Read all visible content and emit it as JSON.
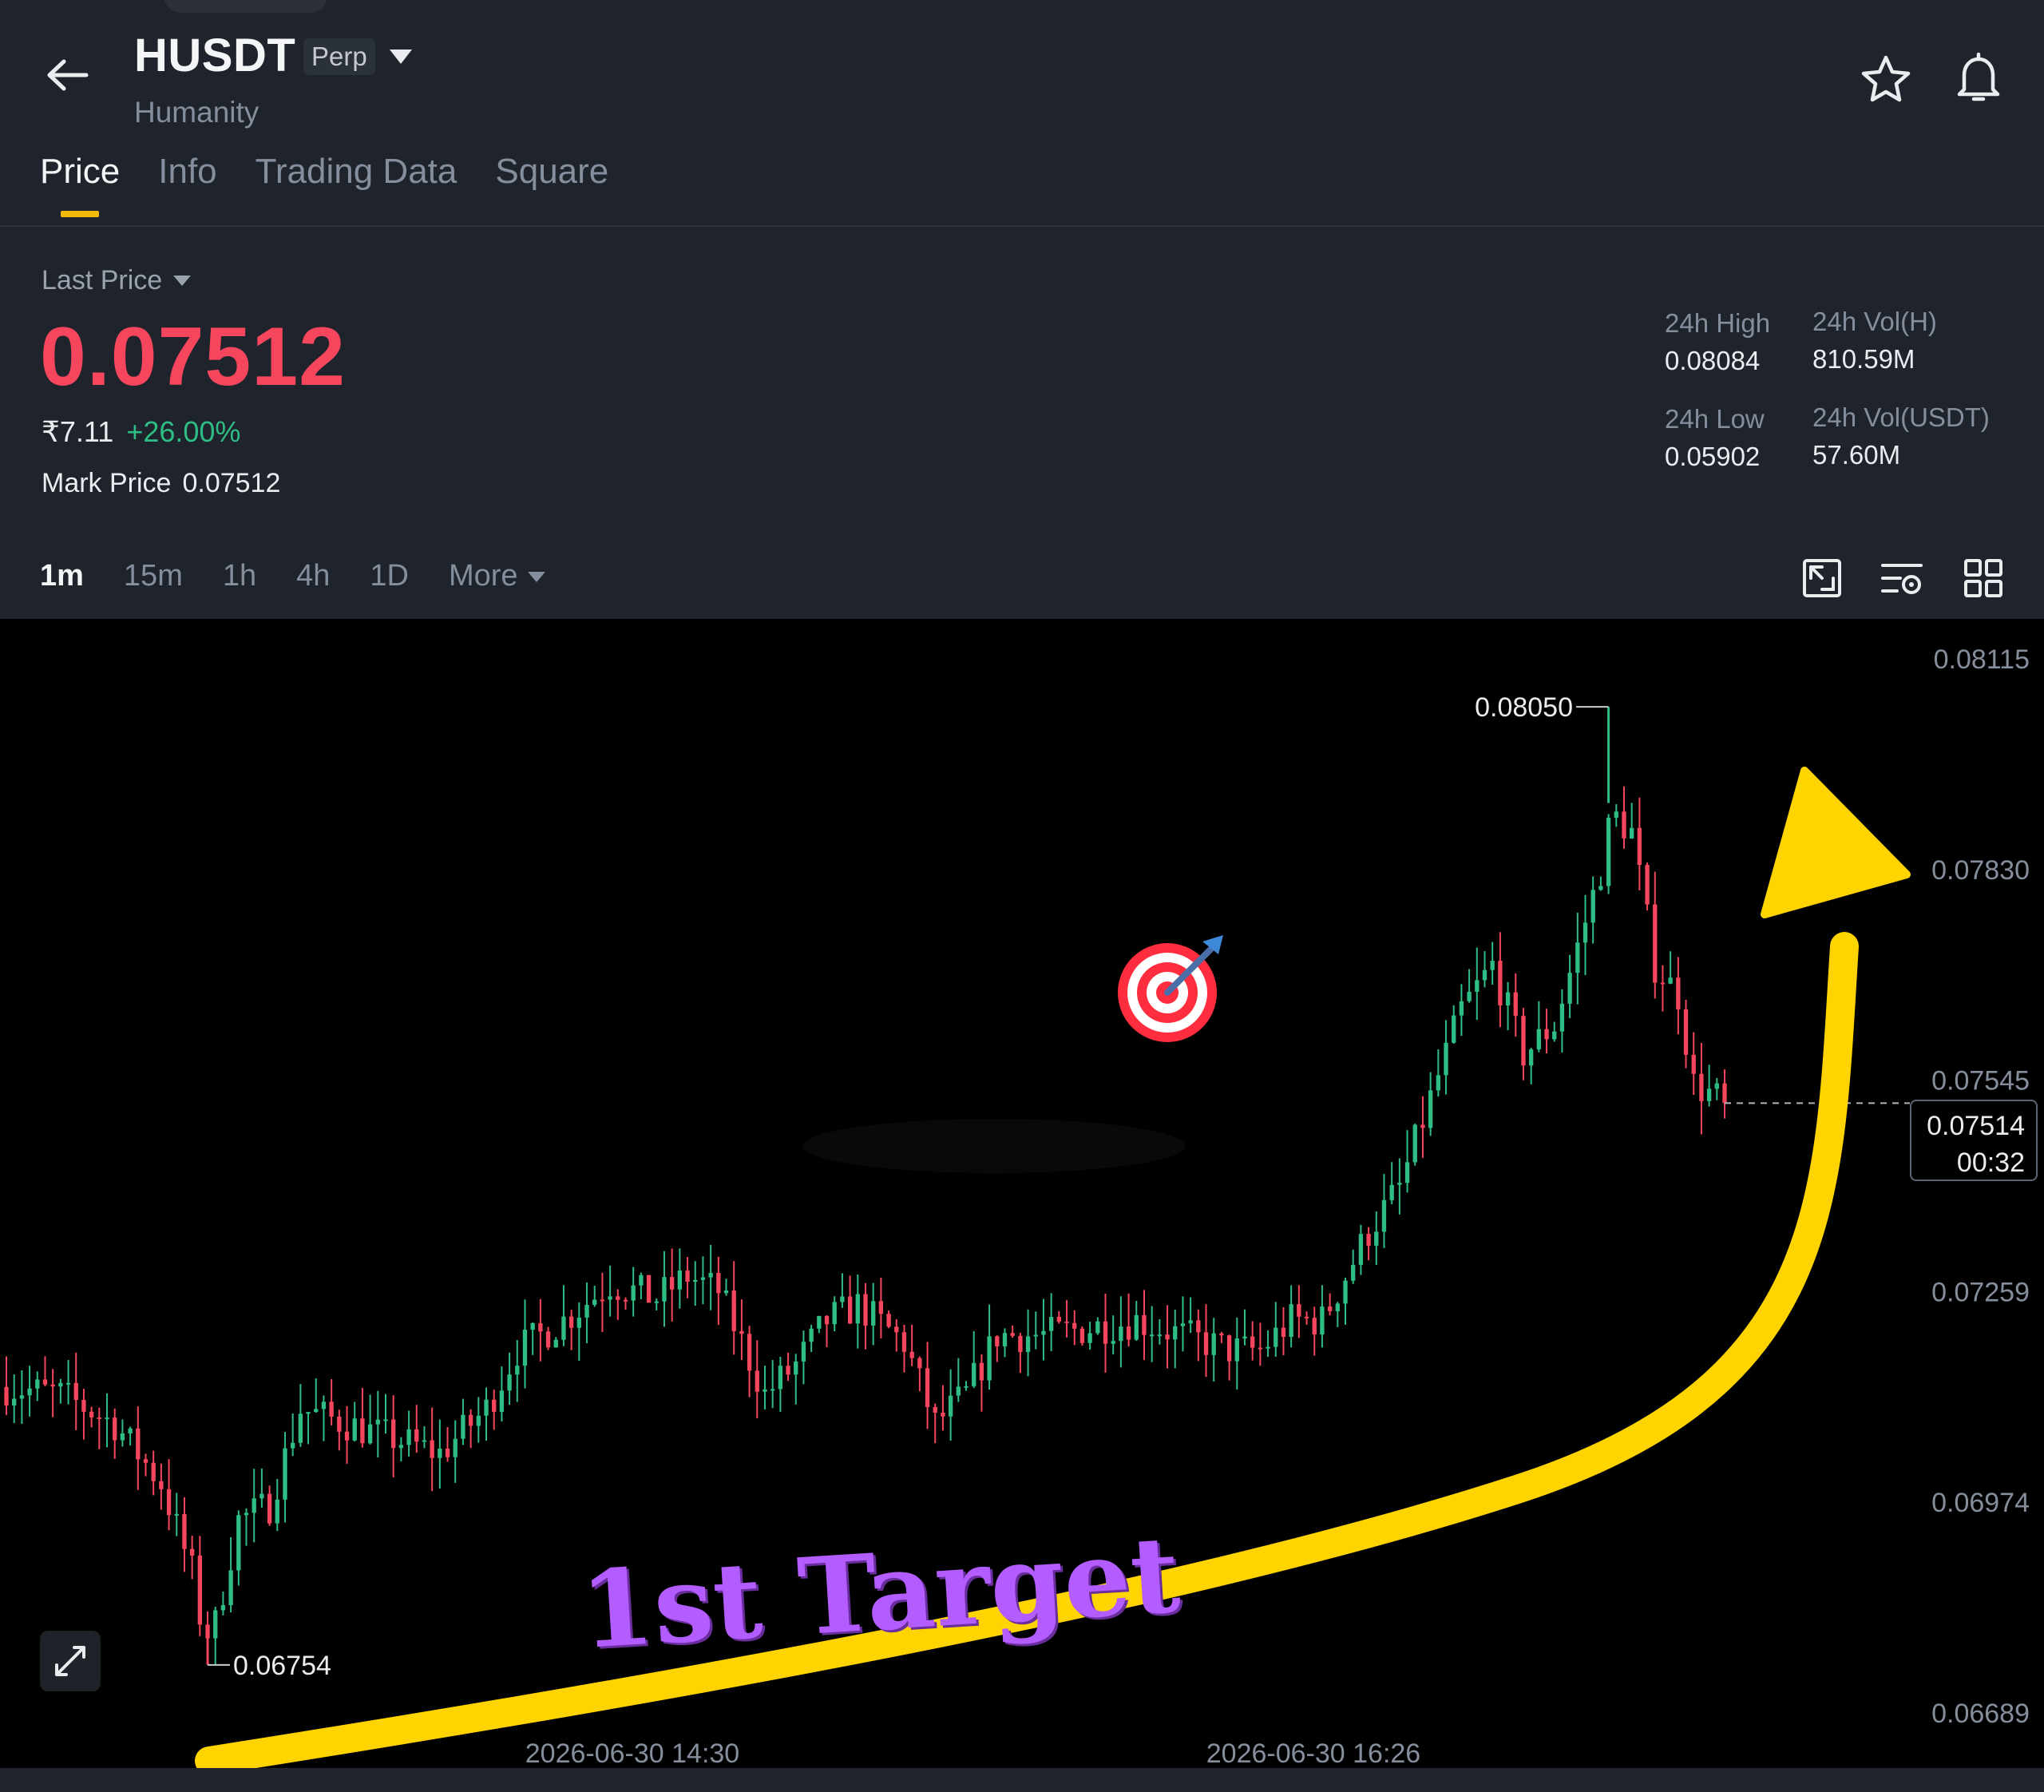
{
  "header": {
    "symbol": "HUSDT",
    "badge": "Perp",
    "subtitle": "Humanity",
    "icons": [
      "back-arrow-icon",
      "star-icon",
      "bell-icon"
    ]
  },
  "tabs": [
    {
      "label": "Price",
      "active": true
    },
    {
      "label": "Info",
      "active": false
    },
    {
      "label": "Trading Data",
      "active": false
    },
    {
      "label": "Square",
      "active": false
    }
  ],
  "price_panel": {
    "last_price_label": "Last Price",
    "last_price": "0.07512",
    "inr_price": "₹7.11",
    "change_pct": "+26.00%",
    "mark_label": "Mark Price",
    "mark_value": "0.07512"
  },
  "stats": {
    "high_label": "24h High",
    "high_value": "0.08084",
    "low_label": "24h Low",
    "low_value": "0.05902",
    "vol_h_label": "24h Vol(H)",
    "vol_h_value": "810.59M",
    "vol_usdt_label": "24h Vol(USDT)",
    "vol_usdt_value": "57.60M"
  },
  "intervals": {
    "items": [
      "1m",
      "15m",
      "1h",
      "4h",
      "1D"
    ],
    "active": "1m",
    "more_label": "More"
  },
  "toolbar_icons": [
    "chart-settings-icon",
    "indicator-icon",
    "layout-grid-icon"
  ],
  "overlay": {
    "text": "1st Target",
    "emoji": "🎯"
  },
  "colors": {
    "up": "#2ebd85",
    "down": "#f6465d",
    "accent": "#f0b90b",
    "arrow": "#ffd400",
    "overlay_text": "#b35cff"
  },
  "chart_data": {
    "type": "candlestick",
    "interval": "1m",
    "ylim": [
      0.06689,
      0.08115
    ],
    "y_ticks": [
      "0.08115",
      "0.07830",
      "0.07545",
      "0.07259",
      "0.06974",
      "0.06689"
    ],
    "x_labels": [
      "2026-06-30 14:30",
      "2026-06-30 16:26"
    ],
    "current_price": "0.07514",
    "countdown": "00:32",
    "high_marker": "0.08050",
    "low_marker": "0.06754",
    "close_path": [
      [
        0,
        0.0713
      ],
      [
        7,
        0.0712
      ],
      [
        14,
        0.0708
      ],
      [
        20,
        0.07
      ],
      [
        24,
        0.0688
      ],
      [
        26,
        0.06762
      ],
      [
        30,
        0.0695
      ],
      [
        34,
        0.0697
      ],
      [
        38,
        0.071
      ],
      [
        44,
        0.0708
      ],
      [
        50,
        0.0706
      ],
      [
        56,
        0.0704
      ],
      [
        62,
        0.071
      ],
      [
        66,
        0.0718
      ],
      [
        72,
        0.0722
      ],
      [
        78,
        0.0727
      ],
      [
        84,
        0.0725
      ],
      [
        88,
        0.0728
      ],
      [
        92,
        0.0726
      ],
      [
        98,
        0.0712
      ],
      [
        102,
        0.0716
      ],
      [
        106,
        0.0722
      ],
      [
        110,
        0.0724
      ],
      [
        116,
        0.0719
      ],
      [
        120,
        0.0708
      ],
      [
        124,
        0.0712
      ],
      [
        128,
        0.072
      ],
      [
        134,
        0.072
      ],
      [
        140,
        0.0721
      ],
      [
        146,
        0.0722
      ],
      [
        152,
        0.072
      ],
      [
        158,
        0.0718
      ],
      [
        162,
        0.0718
      ],
      [
        166,
        0.0722
      ],
      [
        170,
        0.0722
      ],
      [
        176,
        0.0734
      ],
      [
        180,
        0.074
      ],
      [
        184,
        0.0752
      ],
      [
        188,
        0.0764
      ],
      [
        192,
        0.077
      ],
      [
        196,
        0.0758
      ],
      [
        200,
        0.0762
      ],
      [
        204,
        0.0776
      ],
      [
        208,
        0.079
      ],
      [
        210,
        0.0788
      ],
      [
        213,
        0.077
      ],
      [
        216,
        0.0766
      ],
      [
        218,
        0.0754
      ],
      [
        222,
        0.07515
      ]
    ]
  }
}
